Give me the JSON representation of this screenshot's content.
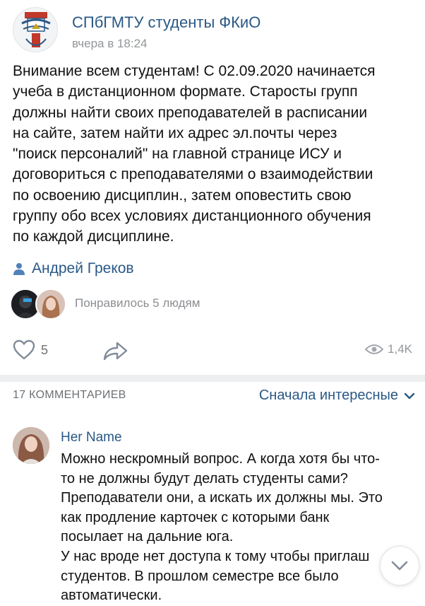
{
  "post": {
    "group_name": "СПбГМТУ студенты ФКиО",
    "time": "вчера в 18:24",
    "text": "Внимание всем студентам! С 02.09.2020 начинается\nучеба в дистанционном формате. Старосты групп\nдолжны найти своих преподавателей в расписании\nна сайте, затем найти их адрес эл.почты через\n\"поиск персоналий\" на главной странице ИСУ и\nдоговориться с преподавателями о взаимодействии\nпо освоению дисциплин., затем оповестить свою\nгруппу обо всех условиях дистанционного обучения\nпо каждой дисциплине.",
    "author": "Андрей Греков",
    "likes_text": "Понравилось 5 людям",
    "like_count": "5",
    "views": "1,4K"
  },
  "comments": {
    "count_label": "17 КОММЕНТАРИЕВ",
    "sort_label": "Сначала интересные",
    "items": [
      {
        "author": "Her Name",
        "text": "Можно нескромный вопрос. А когда хотя бы что-\nто не должны будут делать студенты сами?\nПреподаватели они, а искать их должны мы. Это\nкак продление карточек с которыми банк\nпосылает на дальние юга.\nУ нас вроде нет доступа к тому чтобы приглаш\nстудентов. В прошлом семестре все было\nавтоматически."
      }
    ]
  },
  "icons": {
    "author": "person-icon",
    "like": "heart-icon",
    "share": "share-arrow-icon",
    "views": "eye-icon",
    "sort": "chevron-down-icon",
    "scroll": "chevron-down-icon"
  },
  "colors": {
    "link": "#2a5885",
    "secondary_text": "#939699",
    "divider": "#edeef0",
    "background": "#ffffff"
  }
}
